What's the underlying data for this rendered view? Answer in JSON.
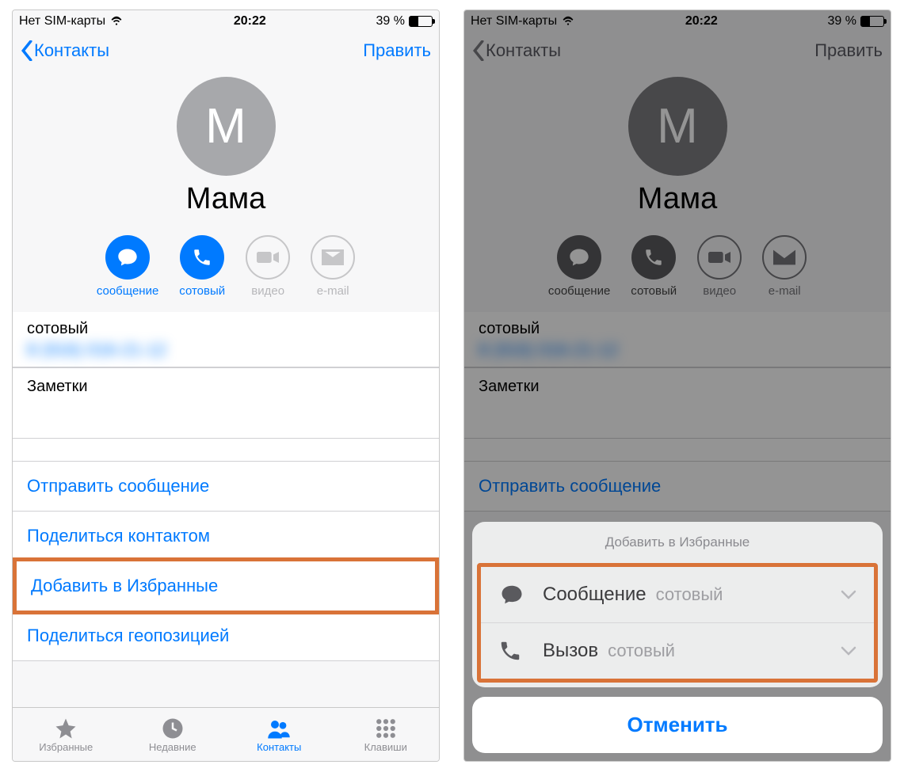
{
  "status": {
    "sim": "Нет SIM-карты",
    "time": "20:22",
    "battery_pct": "39 %"
  },
  "nav": {
    "back": "Контакты",
    "edit": "Править"
  },
  "contact": {
    "initial": "М",
    "name": "Мама"
  },
  "actions": {
    "message": "сообщение",
    "mobile": "сотовый",
    "video": "видео",
    "email": "e-mail"
  },
  "details": {
    "phone_label": "сотовый",
    "notes_label": "Заметки"
  },
  "links": {
    "send_message": "Отправить сообщение",
    "share_contact": "Поделиться контактом",
    "add_favorite": "Добавить в Избранные",
    "share_location": "Поделиться геопозицией"
  },
  "tabs": {
    "favorites": "Избранные",
    "recents": "Недавние",
    "contacts": "Контакты",
    "keypad": "Клавиши"
  },
  "sheet": {
    "title": "Добавить в Избранные",
    "message": "Сообщение",
    "call": "Вызов",
    "sub": "сотовый",
    "cancel": "Отменить"
  }
}
